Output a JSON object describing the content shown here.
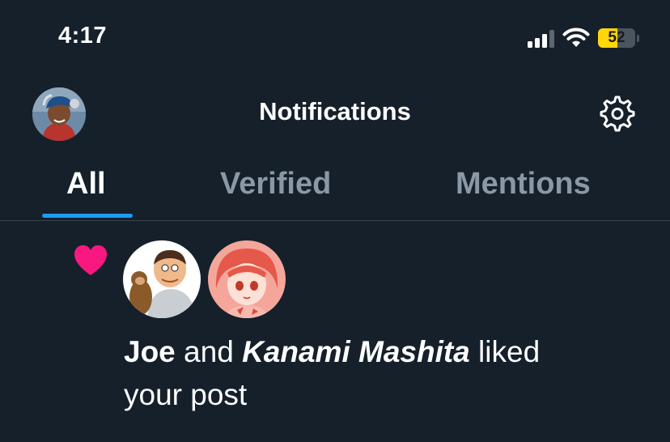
{
  "status_bar": {
    "time": "4:17",
    "battery_level": "52",
    "battery_fraction": 0.52,
    "battery_color": "#ffd60a",
    "signal_bars_active": 3,
    "signal_bars_total": 4
  },
  "header": {
    "title": "Notifications",
    "avatar_icon": "user-avatar",
    "settings_icon": "gear-icon"
  },
  "tabs": [
    {
      "label": "All",
      "active": true
    },
    {
      "label": "Verified",
      "active": false
    },
    {
      "label": "Mentions",
      "active": false
    }
  ],
  "accent_color": "#1d9bf0",
  "notification": {
    "icon": "heart-icon",
    "icon_color": "#f91880",
    "user1": "Joe",
    "connector": "and",
    "user2": "Kanami Mashita",
    "action_line1": "liked",
    "action_line2": "your post"
  }
}
